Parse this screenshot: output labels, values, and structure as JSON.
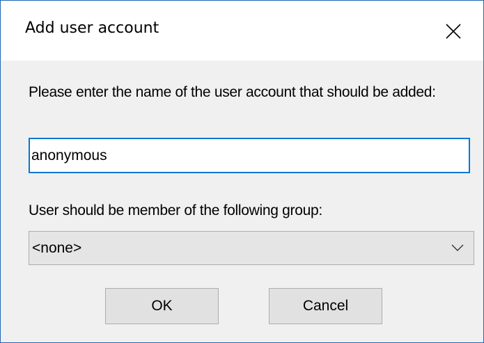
{
  "dialog": {
    "title": "Add user account",
    "prompt": "Please enter the name of the user account that should be added:",
    "username_value": "anonymous",
    "group_label": "User should be member of the following group:",
    "group_selected": "<none>",
    "ok_label": "OK",
    "cancel_label": "Cancel"
  },
  "icons": {
    "close": "close-icon",
    "dropdown": "chevron-down-icon"
  },
  "colors": {
    "title_background": "#ffffff",
    "body_background": "#f0f0f0",
    "window_border": "#1f66b4",
    "input_focus_border": "#0078d7",
    "button_background": "#e1e1e1"
  }
}
